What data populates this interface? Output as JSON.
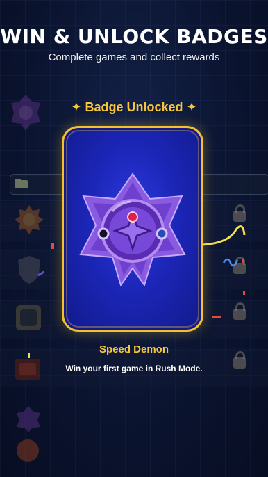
{
  "header": {
    "title": "WIN & UNLOCK BADGES",
    "subtitle": "Complete games and collect rewards"
  },
  "unlock_modal": {
    "title": "✦ Badge Unlocked ✦",
    "badge_name": "Speed Demon",
    "badge_description": "Win your first game in Rush Mode.",
    "badge_icon": "purple-crystal-star-badge-icon"
  },
  "colors": {
    "gold": "#f6c73a",
    "card_blue": "#1c26b8",
    "background": "#0b1430"
  }
}
